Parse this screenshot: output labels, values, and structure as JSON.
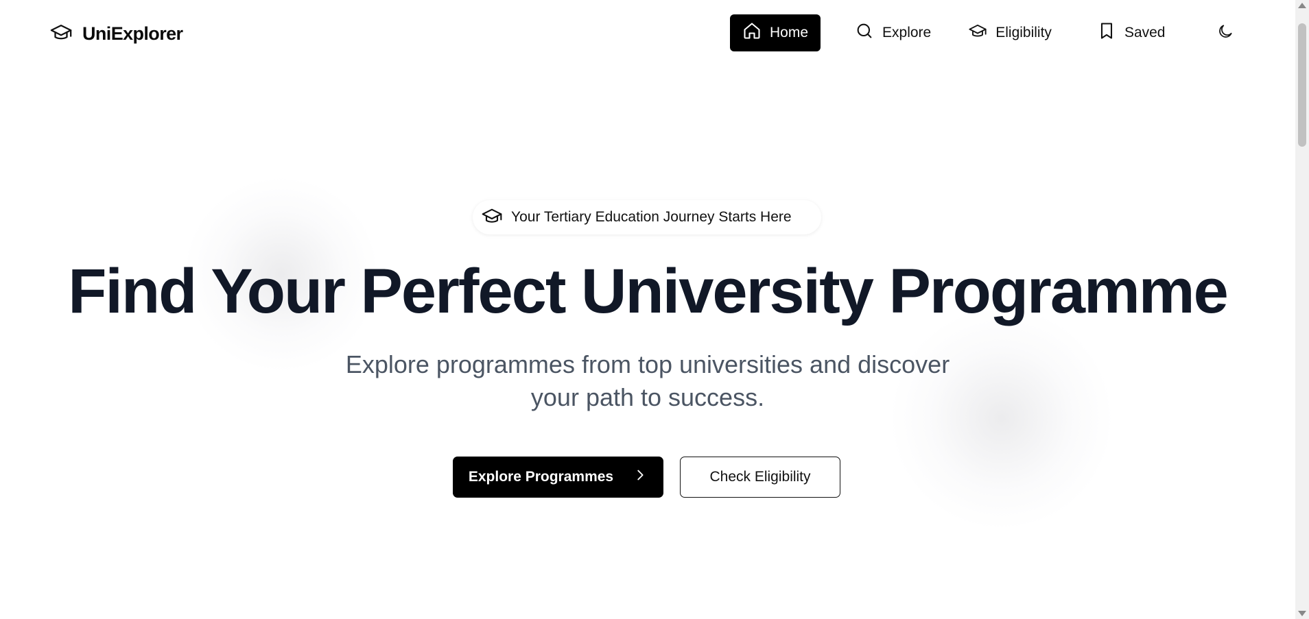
{
  "brand": {
    "name": "UniExplorer",
    "icon": "graduation-cap-icon"
  },
  "nav": {
    "items": [
      {
        "label": "Home",
        "icon": "home-icon",
        "active": true
      },
      {
        "label": "Explore",
        "icon": "search-icon",
        "active": false
      },
      {
        "label": "Eligibility",
        "icon": "graduation-cap-icon",
        "active": false
      },
      {
        "label": "Saved",
        "icon": "bookmark-icon",
        "active": false
      }
    ],
    "theme_toggle_icon": "moon-icon"
  },
  "hero": {
    "badge": "Your Tertiary Education Journey Starts Here",
    "title": "Find Your Perfect University Programme",
    "subtitle_line1": "Explore programmes from top universities and discover",
    "subtitle_line2": "your path to success.",
    "primary_button": "Explore Programmes",
    "secondary_button": "Check Eligibility"
  },
  "colors": {
    "primary": "#000000",
    "text": "#111827",
    "muted": "#4b5563",
    "background": "#ffffff"
  }
}
